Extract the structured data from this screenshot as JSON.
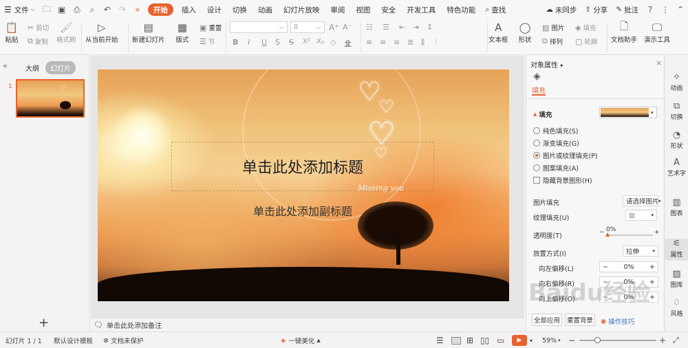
{
  "menubar": {
    "file_label": "文件",
    "tabs": [
      "开始",
      "插入",
      "设计",
      "切换",
      "动画",
      "幻灯片放映",
      "审阅",
      "视图",
      "安全",
      "开发工具",
      "特色功能"
    ],
    "search_label": "查找",
    "sync_label": "未同步",
    "share_label": "分享",
    "comment_label": "批注"
  },
  "ribbon": {
    "paste": "粘贴",
    "cut": "剪切",
    "copy": "复制",
    "format_painter": "格式刷",
    "from_current": "从当前开始",
    "new_slide": "新建幻灯片",
    "layout": "版式",
    "reset": "重置",
    "section": "节",
    "font_size": "0",
    "text_box": "文本框",
    "shape": "形状",
    "picture": "图片",
    "arrange": "排列",
    "fill": "填充",
    "outline": "轮廓",
    "doc_assist": "文档助手",
    "presentation_tools": "演示工具"
  },
  "leftpane": {
    "outline_tab": "大纲",
    "slides_tab": "幻灯片",
    "slide_number": "1"
  },
  "slide": {
    "title_placeholder": "单击此处添加标题",
    "subtitle_placeholder": "单击此处添加副标题",
    "missing_you": "Missing you"
  },
  "notes_placeholder": "单击此处添加备注",
  "props": {
    "header": "对象属性",
    "fill_tab": "填充",
    "fill_section": "填充",
    "options": [
      {
        "label": "纯色填充(S)",
        "selected": false
      },
      {
        "label": "渐变填充(G)",
        "selected": false
      },
      {
        "label": "图片或纹理填充(P)",
        "selected": true
      },
      {
        "label": "图案填充(A)",
        "selected": false
      }
    ],
    "hide_bg": "隐藏背景图形(H)",
    "picture_fill": "图片填充",
    "picture_fill_value": "请选择图片",
    "texture_fill": "纹理填充(U)",
    "transparency": "透明度(T)",
    "transparency_value": "0%",
    "placement": "放置方式(I)",
    "placement_value": "拉伸",
    "left_offset": "向左偏移(L)",
    "left_offset_value": "0%",
    "right_offset": "向右偏移(R)",
    "right_offset_value": "0%",
    "up_offset": "向上偏移(O)",
    "up_offset_value": "0%",
    "apply_all": "全部应用",
    "reset_bg": "重置背景",
    "tips": "操作技巧"
  },
  "rsidebar": [
    "动画",
    "切换",
    "形状",
    "艺术字",
    "图表",
    "属性",
    "图库",
    "风格"
  ],
  "statusbar": {
    "slide_count": "幻灯片 1 / 1",
    "template": "默认设计模板",
    "protection": "文档未保护",
    "beautify": "一键美化",
    "zoom": "59%"
  },
  "watermark": "Baidu经验"
}
